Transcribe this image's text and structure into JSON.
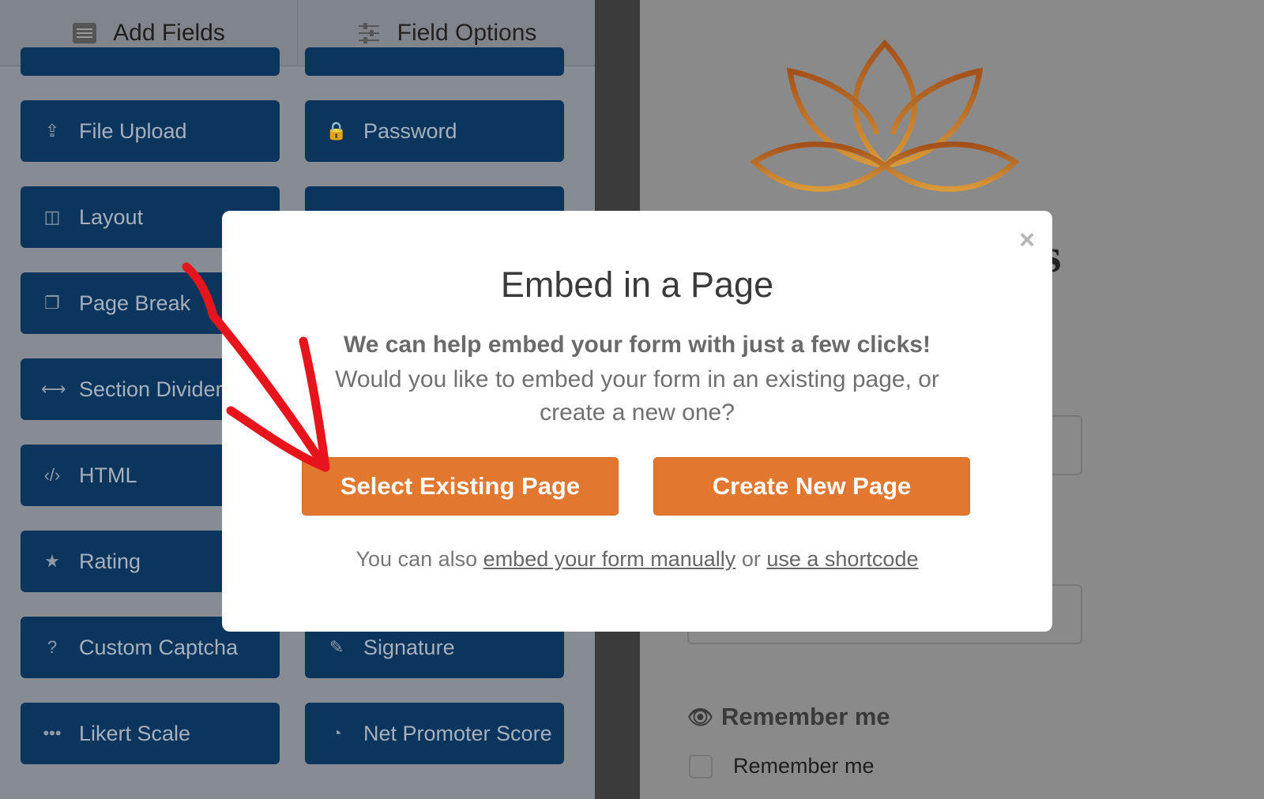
{
  "tabs": [
    {
      "label": "Add Fields",
      "icon": "list-icon"
    },
    {
      "label": "Field Options",
      "icon": "sliders-icon"
    }
  ],
  "fields_left": [
    {
      "label": "File Upload",
      "icon": "upload-icon"
    },
    {
      "label": "Layout",
      "icon": "columns-icon"
    },
    {
      "label": "Page Break",
      "icon": "copy-icon"
    },
    {
      "label": "Section Divider",
      "icon": "arrows-h-icon"
    },
    {
      "label": "HTML",
      "icon": "code-icon"
    },
    {
      "label": "Rating",
      "icon": "star-icon"
    },
    {
      "label": "Custom Captcha",
      "icon": "question-circle-icon"
    },
    {
      "label": "Likert Scale",
      "icon": "ellipsis-icon"
    }
  ],
  "fields_right": [
    {
      "label": "Password",
      "icon": "lock-icon"
    },
    {
      "label": "",
      "icon": ""
    },
    {
      "label": "",
      "icon": ""
    },
    {
      "label": "",
      "icon": ""
    },
    {
      "label": "",
      "icon": ""
    },
    {
      "label": "",
      "icon": ""
    },
    {
      "label": "Signature",
      "icon": "pencil-icon"
    },
    {
      "label": "Net Promoter Score",
      "icon": "gauge-icon"
    }
  ],
  "preview": {
    "heading_fragment": "s",
    "remember_label": "Remember me",
    "remember_checkbox": "Remember me",
    "logo_color": "#c8741e"
  },
  "modal": {
    "title": "Embed in a Page",
    "line1": "We can help embed your form with just a few clicks!",
    "line2": "Would you like to embed your form in an existing page, or create a new one?",
    "select_button": "Select Existing Page",
    "create_button": "Create New Page",
    "footer_prefix": "You can also",
    "footer_link1": "embed your form manually",
    "footer_or": "or",
    "footer_link2": "use a shortcode",
    "close": "×",
    "accent": "#e27730"
  },
  "annotation_color": "#e8141c"
}
